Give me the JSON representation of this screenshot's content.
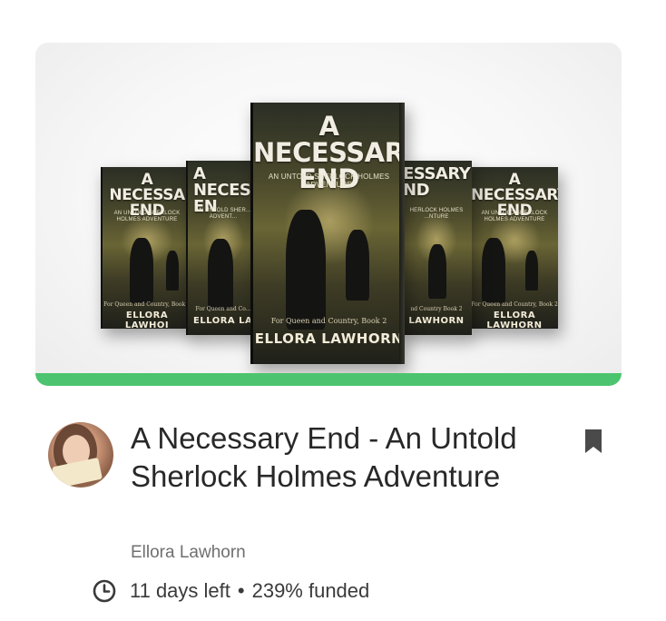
{
  "project": {
    "cover_image": {
      "alt": "A Necessary End book covers",
      "books": [
        {
          "title": "A NECESSA\nEND",
          "subtitle": "AN UNTOLD SHERLOCK HOLMES ADVENTURE",
          "series": "For Queen and Country, Book 2",
          "author": "ELLORA LAWHOI"
        },
        {
          "title": "A NECES\nEN",
          "subtitle": "AN UNTOLD SHER... ADVENT...",
          "series": "For Queen and Co...",
          "author": "ELLORA LA"
        },
        {
          "title": "ESSARY\nND",
          "subtitle": "HERLOCK HOLMES ...NTURE",
          "series": "nd Country Book 2",
          "author": "LAWHORN"
        },
        {
          "title": "NECESSARY\nEND",
          "subtitle": "OLD SHERLOCK HOLMES ADVENTURE",
          "series": "For Queen and Country Book 2",
          "author": "LORA LAWHORN"
        },
        {
          "title": "A NECESSARY\nEND",
          "subtitle": "AN UNTOLD SHERLOCK HOLMES ADVENTURE",
          "series": "For Queen and Country, Book 2",
          "author": "ELLORA LAWHORN"
        }
      ]
    },
    "funding_progress": 1.0,
    "title": "A Necessary End - An Untold Sherlock Holmes Adventure",
    "creator": "Ellora Lawhorn",
    "days_left": "11 days left",
    "separator": "•",
    "funded": "239% funded",
    "colors": {
      "progress": "#4cc46f",
      "text": "#282828",
      "muted": "#6f6f6f"
    },
    "icons": {
      "bookmark": "bookmark-icon",
      "clock": "clock-icon"
    }
  }
}
